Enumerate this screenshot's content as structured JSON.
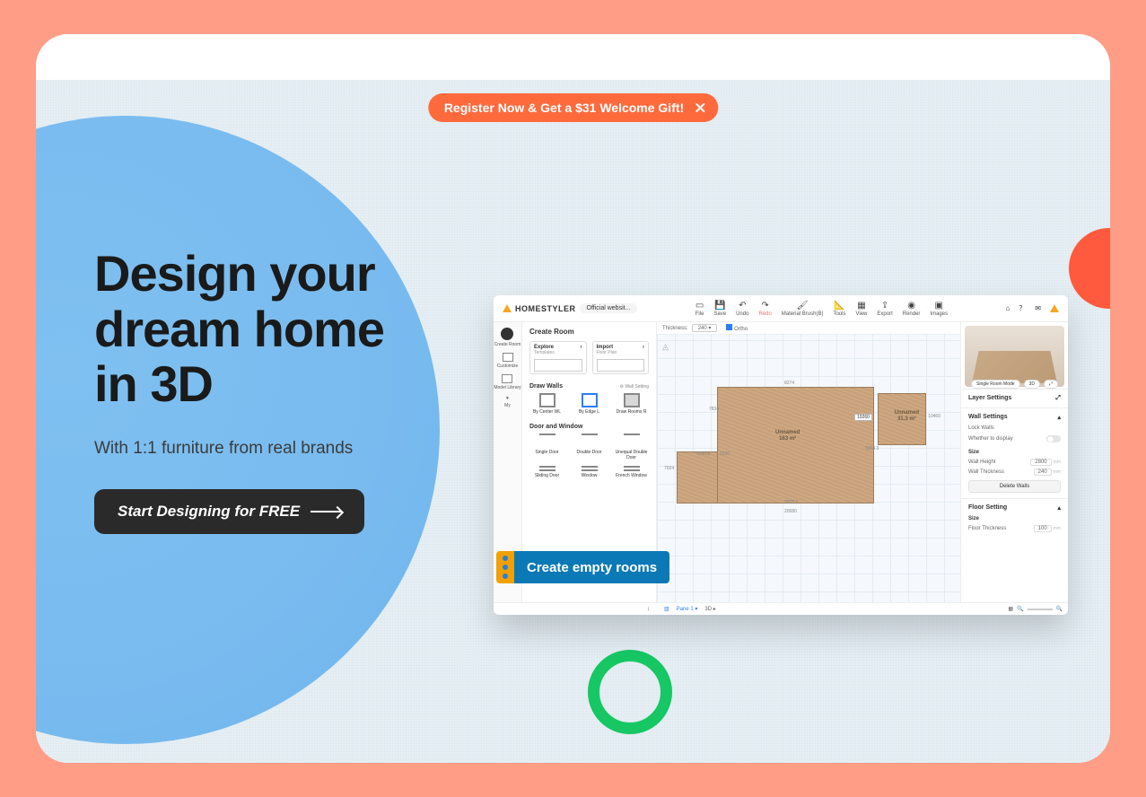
{
  "banner": {
    "text": "Register Now & Get a $31 Welcome Gift!"
  },
  "hero": {
    "title_line1": "Design your",
    "title_line2": "dream home",
    "title_line3": "in 3D",
    "subtitle": "With 1:1 furniture from real brands",
    "cta": "Start Designing for FREE"
  },
  "tooltip": {
    "text": "Create empty rooms"
  },
  "editor": {
    "brand": "HOMESTYLER",
    "source_chip": "Official websit...",
    "tools_center": [
      "File",
      "Save",
      "Undo",
      "Redo",
      "Material Brush(B)",
      "Tools",
      "View",
      "Export",
      "Render",
      "Images"
    ],
    "leftcol": [
      "Create Room",
      "Customize",
      "Model Library",
      "My"
    ],
    "panel": {
      "title": "Create Room",
      "explore": "Explore",
      "explore_sub": "Templates",
      "import": "Import",
      "import_sub": "Floor Plan",
      "draw_walls": "Draw Walls",
      "wall_setting": "Wall Setting",
      "wall_items": [
        "By Center WL",
        "By Edge L",
        "Draw Rooms R"
      ],
      "door_section": "Door and Window",
      "door_items_row1": [
        "Single Door",
        "Double Door",
        "Unequal Double Door"
      ],
      "door_items_row2": [
        "Sliding Door",
        "Window",
        "French Window"
      ]
    },
    "subbar": {
      "thickness_label": "Thickness:",
      "thickness_value": "240",
      "ortho": "Ortho"
    },
    "rooms": {
      "a_name": "Unnamed",
      "a_area": "163 m²",
      "b_name": "Unnamed",
      "b_area": "31.3 m²",
      "dim_top": "8274",
      "dim_left": "7834",
      "dim_left2": "7024",
      "dim_bottom_mid": "7075.7",
      "dim_bottom": "20680",
      "dim_box": "10260",
      "dim_right": "10460",
      "dim_left3": "5030",
      "dim_topA": "5004.3",
      "dim_bboxA": "5540.8"
    },
    "preview": {
      "mode": "Single Room Mode",
      "view1": "3D",
      "view2": "⤢"
    },
    "right": {
      "layer": "Layer Settings",
      "wall_settings": "Wall Settings",
      "lock_walls": "Lock Walls",
      "whether_display": "Whether to display",
      "size": "Size",
      "wall_height": "Wall Height",
      "wall_height_val": "2800",
      "wall_thickness": "Wall Thickness",
      "wall_thickness_val": "240",
      "unit": "mm",
      "delete_walls": "Delete Walls",
      "floor_setting": "Floor Setting",
      "size2": "Size",
      "floor_thickness": "Floor Thickness",
      "floor_thickness_val": "100"
    },
    "footer": {
      "expand": "↕",
      "pane1": "Pane 1",
      "view3d": "3D"
    }
  }
}
